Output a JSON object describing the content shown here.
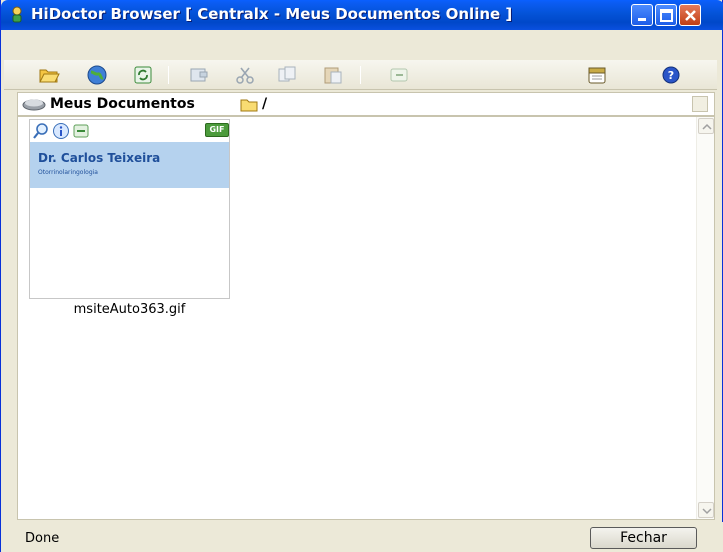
{
  "window": {
    "title": "HiDoctor Browser [ Centralx - Meus Documentos Online ]"
  },
  "toolbar": {
    "icons": [
      "open-folder-icon",
      "globe-icon",
      "refresh-icon",
      "properties-icon",
      "cut-icon",
      "copy-icon",
      "paste-icon",
      "undo-icon",
      "calendar-icon",
      "help-icon"
    ]
  },
  "address": {
    "label": "Meus Documentos",
    "path": "/"
  },
  "file": {
    "name": "msiteAuto363.gif",
    "type_badge": "GIF",
    "preview_name": "Dr. Carlos Teixeira",
    "preview_specialty": "Otorrinolaringologia"
  },
  "status": {
    "text": "Done",
    "close_label": "Fechar"
  },
  "colors": {
    "titlebar": "#0453d8",
    "banner": "#b5d2ee",
    "banner_text": "#1f4f9a"
  }
}
